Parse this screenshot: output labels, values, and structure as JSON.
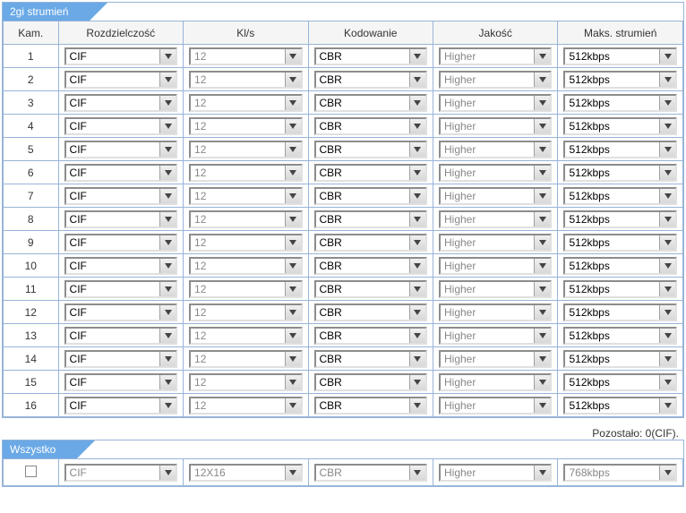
{
  "tab1": "2gi strumień",
  "tab2": "Wszystko",
  "headers": {
    "kam": "Kam.",
    "res": "Rozdzielczość",
    "fps": "Kl/s",
    "enc": "Kodowanie",
    "qual": "Jakość",
    "bit": "Maks. strumień"
  },
  "rows": [
    {
      "kam": "1",
      "res": "CIF",
      "fps": "12",
      "enc": "CBR",
      "qual": "Higher",
      "bit": "512kbps"
    },
    {
      "kam": "2",
      "res": "CIF",
      "fps": "12",
      "enc": "CBR",
      "qual": "Higher",
      "bit": "512kbps"
    },
    {
      "kam": "3",
      "res": "CIF",
      "fps": "12",
      "enc": "CBR",
      "qual": "Higher",
      "bit": "512kbps"
    },
    {
      "kam": "4",
      "res": "CIF",
      "fps": "12",
      "enc": "CBR",
      "qual": "Higher",
      "bit": "512kbps"
    },
    {
      "kam": "5",
      "res": "CIF",
      "fps": "12",
      "enc": "CBR",
      "qual": "Higher",
      "bit": "512kbps"
    },
    {
      "kam": "6",
      "res": "CIF",
      "fps": "12",
      "enc": "CBR",
      "qual": "Higher",
      "bit": "512kbps"
    },
    {
      "kam": "7",
      "res": "CIF",
      "fps": "12",
      "enc": "CBR",
      "qual": "Higher",
      "bit": "512kbps"
    },
    {
      "kam": "8",
      "res": "CIF",
      "fps": "12",
      "enc": "CBR",
      "qual": "Higher",
      "bit": "512kbps"
    },
    {
      "kam": "9",
      "res": "CIF",
      "fps": "12",
      "enc": "CBR",
      "qual": "Higher",
      "bit": "512kbps"
    },
    {
      "kam": "10",
      "res": "CIF",
      "fps": "12",
      "enc": "CBR",
      "qual": "Higher",
      "bit": "512kbps"
    },
    {
      "kam": "11",
      "res": "CIF",
      "fps": "12",
      "enc": "CBR",
      "qual": "Higher",
      "bit": "512kbps"
    },
    {
      "kam": "12",
      "res": "CIF",
      "fps": "12",
      "enc": "CBR",
      "qual": "Higher",
      "bit": "512kbps"
    },
    {
      "kam": "13",
      "res": "CIF",
      "fps": "12",
      "enc": "CBR",
      "qual": "Higher",
      "bit": "512kbps"
    },
    {
      "kam": "14",
      "res": "CIF",
      "fps": "12",
      "enc": "CBR",
      "qual": "Higher",
      "bit": "512kbps"
    },
    {
      "kam": "15",
      "res": "CIF",
      "fps": "12",
      "enc": "CBR",
      "qual": "Higher",
      "bit": "512kbps"
    },
    {
      "kam": "16",
      "res": "CIF",
      "fps": "12",
      "enc": "CBR",
      "qual": "Higher",
      "bit": "512kbps"
    }
  ],
  "remaining": "Pozostało: 0(CIF).",
  "all": {
    "res": "CIF",
    "fps": "12X16",
    "enc": "CBR",
    "qual": "Higher",
    "bit": "768kbps"
  }
}
